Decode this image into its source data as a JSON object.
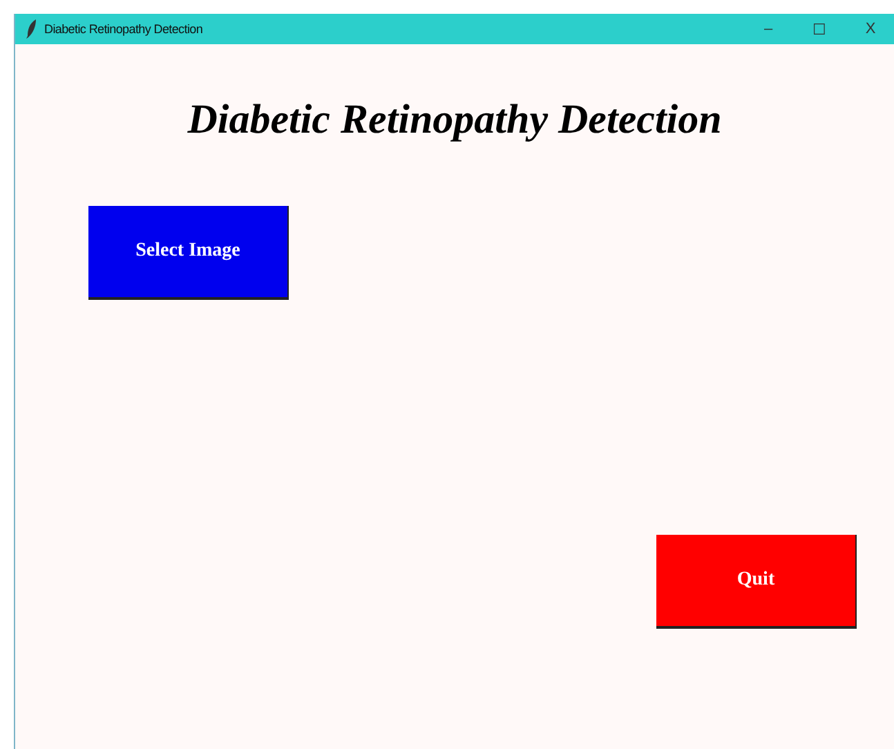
{
  "window": {
    "title": "Diabetic Retinopathy Detection",
    "controls": [
      "–",
      "☐",
      "X"
    ]
  },
  "heading": "Diabetic Retinopathy Detection",
  "buttons": [
    {
      "label": "Select Image",
      "color": "#0000ee"
    },
    {
      "label": "Quit",
      "color": "#ff0000"
    }
  ]
}
